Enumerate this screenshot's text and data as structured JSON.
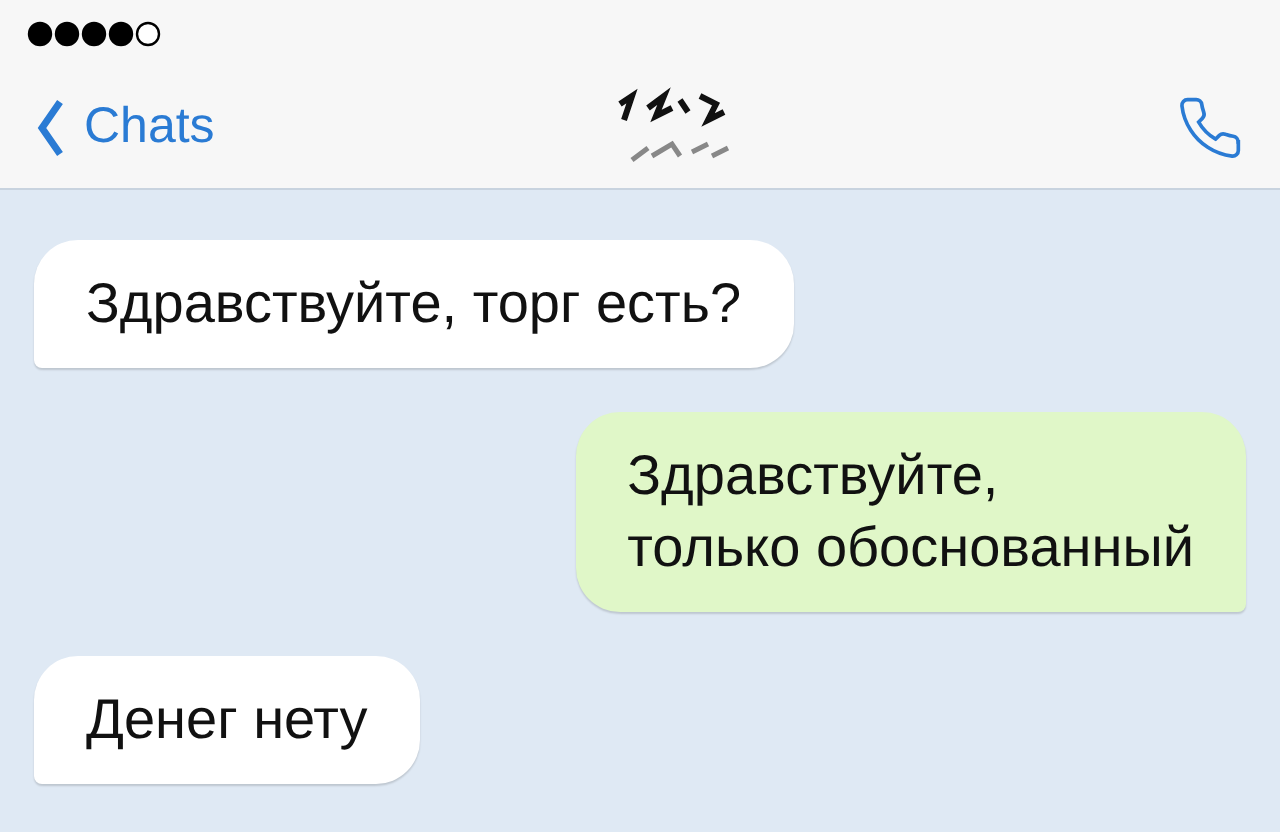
{
  "nav": {
    "back_label": "Chats"
  },
  "messages": [
    {
      "kind": "incoming",
      "text": "Здравствуйте, торг есть?"
    },
    {
      "kind": "outgoing",
      "text": "Здравствуйте,\nтолько обоснованный"
    },
    {
      "kind": "incoming",
      "text": "Денег нету"
    }
  ]
}
